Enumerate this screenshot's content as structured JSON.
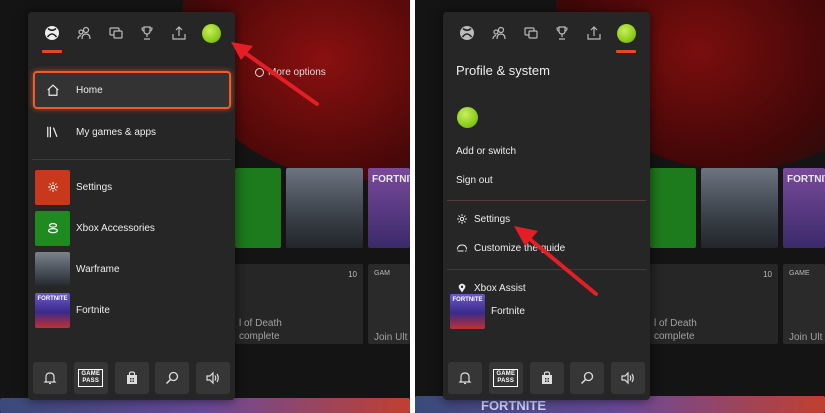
{
  "left": {
    "more_options": "More options",
    "menu": {
      "home": "Home",
      "games_apps": "My games & apps"
    },
    "recent": [
      {
        "label": "Settings"
      },
      {
        "label": "Xbox Accessories"
      },
      {
        "label": "Warframe"
      },
      {
        "label": "Fortnite"
      }
    ],
    "fortnite_thumb": "FORTNITE",
    "bg_fortnite": "FORTNITE",
    "bg_death": "l of Death",
    "bg_complete": "complete",
    "bg_count": "10",
    "bg_gam": "GAM"
  },
  "right": {
    "heading": "Profile & system",
    "add_switch": "Add or switch",
    "sign_out": "Sign out",
    "settings": "Settings",
    "customize": "Customize the guide",
    "xbox_assist": "Xbox Assist",
    "fortnite": "Fortnite",
    "fortnite_thumb": "FORTNITE",
    "bg_fortnite": "FORTNITE",
    "bg_fortnite2": "FORTNITE",
    "bg_death": "l of Death",
    "bg_complete": "complete",
    "bg_join": "Join Ult",
    "bg_count": "10",
    "bg_gam": "GAME"
  },
  "left_bg_join": "Join Ult",
  "bottombar": {
    "gamepass_line1": "GAME",
    "gamepass_line2": "PASS"
  },
  "colors": {
    "accent": "#e7481e",
    "arrow": "#e31e24",
    "settings_tile": "#c8381a",
    "accessories_tile": "#1f8a1f"
  }
}
